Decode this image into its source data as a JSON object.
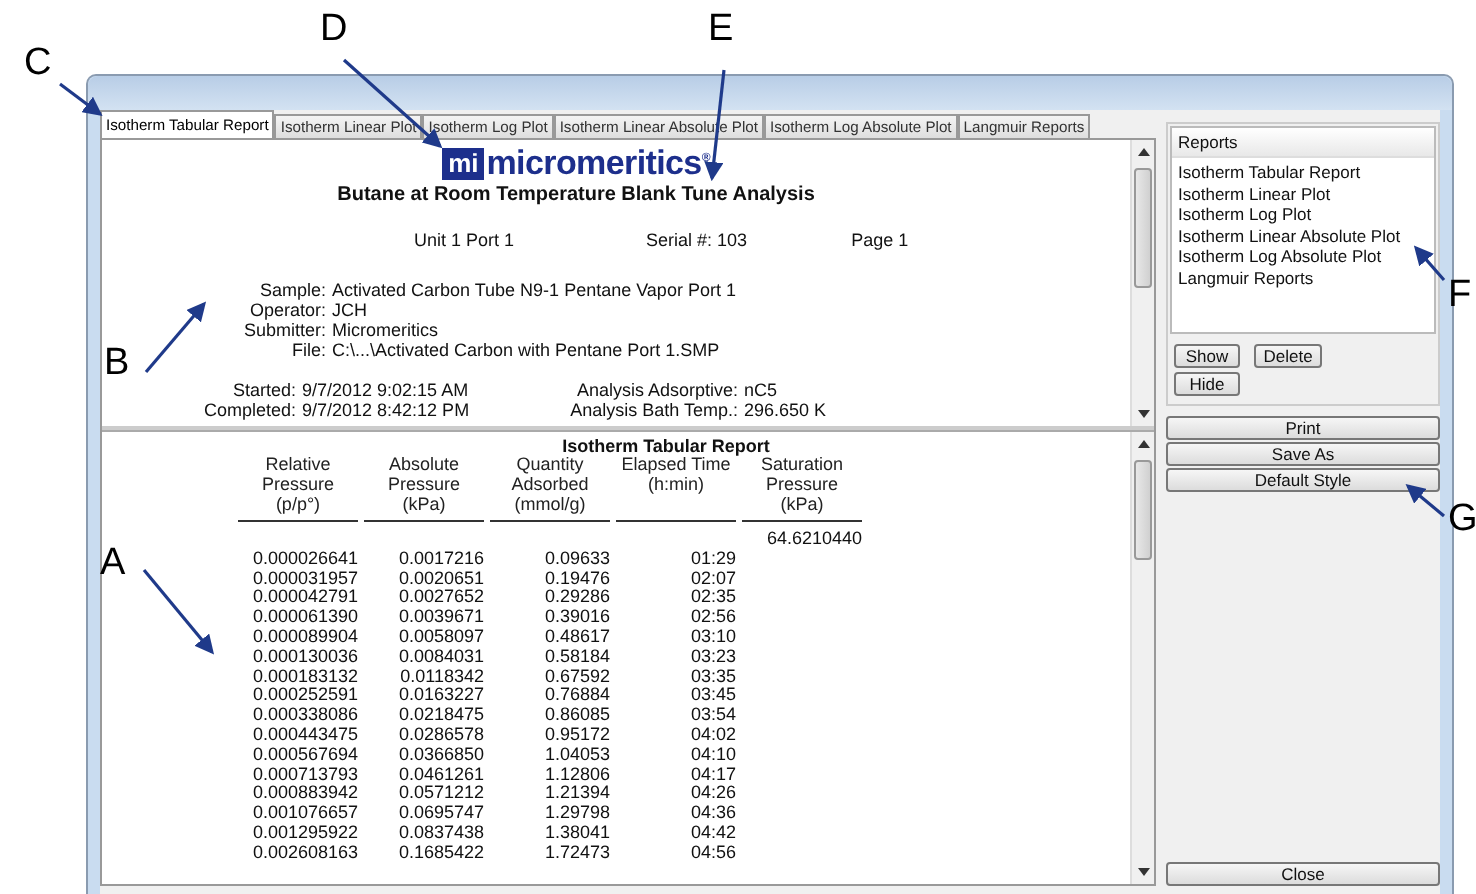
{
  "annotations": [
    {
      "label": "C"
    },
    {
      "label": "D"
    },
    {
      "label": "E"
    },
    {
      "label": "B"
    },
    {
      "label": "A"
    },
    {
      "label": "F"
    },
    {
      "label": "G"
    }
  ],
  "tabs": [
    {
      "label": "Isotherm Tabular Report",
      "selected": true
    },
    {
      "label": "Isotherm Linear Plot",
      "selected": false
    },
    {
      "label": "Isotherm Log Plot",
      "selected": false
    },
    {
      "label": "Isotherm Linear Absolute Plot",
      "selected": false
    },
    {
      "label": "Isotherm Log Absolute Plot",
      "selected": false
    },
    {
      "label": "Langmuir Reports",
      "selected": false
    }
  ],
  "report": {
    "logo_mark": "mi",
    "logo_text": "micromeritics$^{®}$",
    "title": "Butane at Room Temperature Blank Tune Analysis",
    "header": [
      "Unit 1 Port 1",
      "Serial #: 103",
      "Page  1"
    ],
    "sample_info": [
      {
        "label": "Sample:",
        "value": "Activated Carbon Tube N9-1 Pentane Vapor Port 1"
      },
      {
        "label": "Operator:",
        "value": "JCH"
      },
      {
        "label": "Submitter:",
        "value": "Micromeritics"
      },
      {
        "label": "File:",
        "value": "C:\\...\\Activated Carbon with Pentane Port 1.SMP"
      }
    ],
    "run_info": [
      {
        "label": "Started:",
        "value": "9/7/2012 9:02:15 AM",
        "label_2": "Analysis Adsorptive:",
        "value_2": "nC5"
      },
      {
        "label": "Completed:",
        "value": "9/7/2012 8:42:12 PM",
        "label_2": "Analysis Bath Temp.:",
        "value_2": "296.650 K"
      }
    ]
  },
  "table": {
    "title": "Isotherm Tabular Report",
    "columns": [
      "Relative\nPressure (p/p°)",
      "Absolute\nPressure (kPa)",
      "Quantity\nAdsorbed\n(mmol/g)",
      "Elapsed Time\n(h:min)",
      "Saturation\nPressure (kPa)"
    ],
    "saturation": "64.6210440",
    "rows": [
      [
        "0.000026641",
        "0.0017216",
        "0.09633",
        "01:29"
      ],
      [
        "0.000031957",
        "0.0020651",
        "0.19476",
        "02:07"
      ],
      [
        "0.000042791",
        "0.0027652",
        "0.29286",
        "02:35"
      ],
      [
        "0.000061390",
        "0.0039671",
        "0.39016",
        "02:56"
      ],
      [
        "0.000089904",
        "0.0058097",
        "0.48617",
        "03:10"
      ],
      [
        "0.000130036",
        "0.0084031",
        "0.58184",
        "03:23"
      ],
      [
        "0.000183132",
        "0.0118342",
        "0.67592",
        "03:35"
      ],
      [
        "0.000252591",
        "0.0163227",
        "0.76884",
        "03:45"
      ],
      [
        "0.000338086",
        "0.0218475",
        "0.86085",
        "03:54"
      ],
      [
        "0.000443475",
        "0.0286578",
        "0.95172",
        "04:02"
      ],
      [
        "0.000567694",
        "0.0366850",
        "1.04053",
        "04:10"
      ],
      [
        "0.000713793",
        "0.0461261",
        "1.12806",
        "04:17"
      ],
      [
        "0.000883942",
        "0.0571212",
        "1.21394",
        "04:26"
      ],
      [
        "0.001076657",
        "0.0695747",
        "1.29798",
        "04:36"
      ],
      [
        "0.001295922",
        "0.0837438",
        "1.38041",
        "04:42"
      ],
      [
        "0.002608163",
        "0.1685422",
        "1.72473",
        "04:56"
      ]
    ]
  },
  "side_panel": {
    "list_title": "Reports",
    "items": [
      {
        "label": "Isotherm Tabular Report",
        "selected": false
      },
      {
        "label": "Isotherm Linear Plot",
        "selected": false
      },
      {
        "label": "Isotherm Log Plot",
        "selected": false
      },
      {
        "label": "Isotherm Linear Absolute Plot",
        "selected": false
      },
      {
        "label": "Isotherm Log Absolute Plot",
        "selected": false
      },
      {
        "label": "Langmuir Reports",
        "selected": false
      }
    ],
    "list_buttons": [
      "Show",
      "Delete",
      "Hide"
    ],
    "buttons": [
      "Print",
      "Save As",
      "Default Style"
    ],
    "close_button": "Close"
  }
}
